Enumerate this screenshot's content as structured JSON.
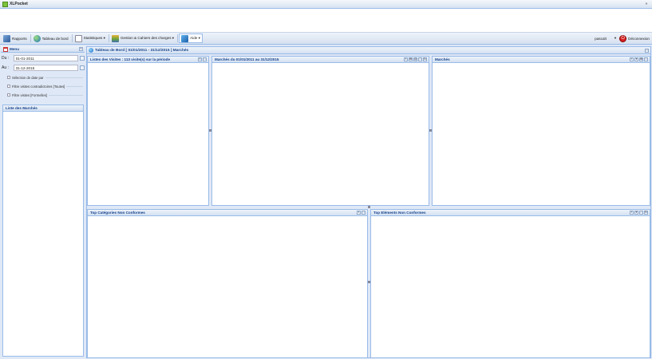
{
  "window": {
    "title": "XLPocket"
  },
  "toolbar": {
    "items": [
      {
        "label": "Rapports",
        "icon": "reports-icon"
      },
      {
        "label": "Tableau de bord",
        "icon": "dashboard-globe-icon"
      },
      {
        "label": "Statistiques ▾",
        "icon": "statistics-icon"
      },
      {
        "label": "Gestion & Cahiers des charges ▾",
        "icon": "books-icon"
      },
      {
        "label": "Aide ▾",
        "icon": "help-icon"
      }
    ],
    "user": "pascalt",
    "user_arrow": "▾",
    "logout": "Déconnexion"
  },
  "menu": {
    "title": "Menu",
    "date_from_label": "Du :",
    "date_from": "01-01-2011",
    "date_to_label": "Au :",
    "date_to": "31-12-2015",
    "filters": [
      "Sélection de date par",
      "Filtre visites contradictoires [Toutes]",
      "Filtre visites [Formelles]"
    ],
    "market_list_title": "Liste des Marchés"
  },
  "dashboard": {
    "title": "Tableau de Bord [ 01/01/2011 - 31/12/2015 ] Marchés",
    "panels": {
      "visits": "Listes des Visites : 113 visite(s) sur la période",
      "markets_period": "Marchés du 01/01/2011 au 31/12/2015",
      "markets": "Marchés",
      "top_categories": "Top Catégories Non Conformes",
      "top_elements": "Top Eléments Non Conformes"
    }
  },
  "colors": {
    "accent": "#15428b",
    "border": "#99bbe8",
    "logout": "#d42020"
  }
}
